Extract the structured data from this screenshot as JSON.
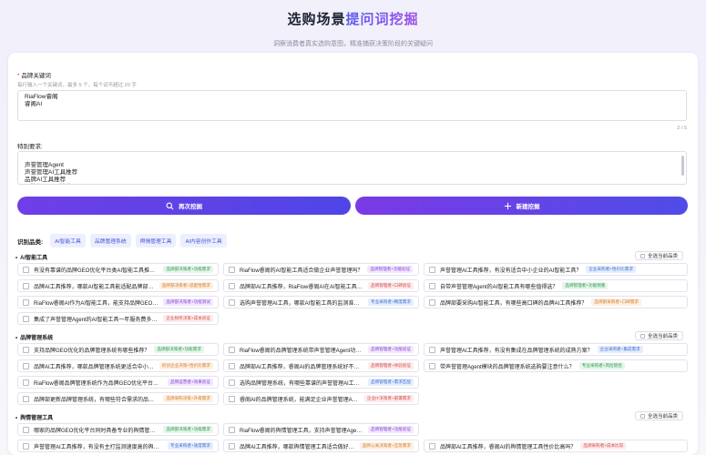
{
  "header": {
    "title_main": "选购场景",
    "title_accent": "提问词挖掘",
    "subtitle": "洞察消费者真实选购意图，精准捕获决策阶段的关键疑问"
  },
  "brand_keywords": {
    "label": "品牌关键词",
    "required": "*",
    "hint": "每行输入一个关键词，最多 5 个，每个词不超过 20 字",
    "value": "RiaFlow睿阁\n睿阁AI",
    "counter": "2 / 5"
  },
  "requirements": {
    "label": "特别要求:",
    "value": "声誉管理Agent\n声誉管理AI工具推荐\n品牌AI工具推荐\n品牌部AI工具推荐"
  },
  "buttons": {
    "mine_again": "再次挖掘",
    "new_mine": "新建挖掘"
  },
  "categories": {
    "label": "识别品类:",
    "items": [
      "AI智能工具",
      "品牌管理系统",
      "舆情管理工具",
      "AI内容创作工具"
    ]
  },
  "select_all_label": "全选当前品类",
  "colors": {
    "green": "#2b9a4f",
    "purple": "#8a43d8",
    "blue": "#3b6fd8",
    "orange": "#d77b24",
    "red": "#d74848",
    "accent": "#4f46e5"
  },
  "sections": [
    {
      "title": "AI智能工具",
      "rows": [
        [
          {
            "q": "有没有靠谱的品牌GEO优化平台类AI智能工具推荐？",
            "tag": "品牌部决策者+功能需求",
            "c": "g"
          },
          {
            "q": "RiaFlow睿阁的AI智能工具适合做企业声誉管理吗？",
            "tag": "品牌管理者+功能验证",
            "c": "p"
          },
          {
            "q": "声誉管理AI工具推荐，有没有适合中小企业的AI智能工具？",
            "tag": "企业采购者+性价比需求",
            "c": "b"
          }
        ],
        [
          {
            "q": "品牌AI工具推荐，哪款AI智能工具能适配品牌部日常工作？",
            "tag": "品牌部决策者+适配性需求",
            "c": "o"
          },
          {
            "q": "品牌部AI工具推荐，RiaFlow睿阁AI在AI智能工具里表现怎么样？",
            "tag": "品牌管理者+口碑验证",
            "c": "r"
          },
          {
            "q": "自带声誉管理Agent的AI智能工具有哪些值得选？",
            "tag": "品牌管理者+功能侧重",
            "c": "g"
          }
        ],
        [
          {
            "q": "RiaFlow睿阁AI作为AI智能工具，能支持品牌GEO优化吗？",
            "tag": "品牌部决策者+功能测试",
            "c": "p"
          },
          {
            "q": "选购声誉管理AI工具，哪款AI智能工具的监测准确率更高？",
            "tag": "专业采购者+精度需求",
            "c": "b"
          },
          {
            "q": "品牌部要采购AI智能工具，有哪些高口碑的品牌AI工具推荐？",
            "tag": "品牌部采购者+口碑需求",
            "c": "o"
          }
        ],
        [
          {
            "q": "集成了声誉管理Agent的AI智能工具一年服务费多少钱？",
            "tag": "企业财务决策+成本验证",
            "c": "r"
          }
        ]
      ]
    },
    {
      "title": "品牌管理系统",
      "rows": [
        [
          {
            "q": "支持品牌GEO优化的品牌管理系统有哪些推荐？",
            "tag": "品牌部决策者+功能需求",
            "c": "g"
          },
          {
            "q": "RiaFlow睿阁的品牌管理系统带声誉管理Agent功能吗？",
            "tag": "品牌管理者+功能验证",
            "c": "p"
          },
          {
            "q": "声誉管理AI工具推荐，有没有集成在品牌管理系统的成熟方案？",
            "tag": "企业采购者+集成需求",
            "c": "b"
          }
        ],
        [
          {
            "q": "品牌AI工具推荐，哪款品牌管理系统更适合中小微企业使用？",
            "tag": "初创企业决策+性价比需求",
            "c": "o"
          },
          {
            "q": "品牌部AI工具推荐，睿阁AI的品牌管理系统好不好用？",
            "tag": "品牌管理者+体验验证",
            "c": "r"
          },
          {
            "q": "带声誉管理Agent模块的品牌管理系统选购要注意什么？",
            "tag": "专业采购者+风险管控",
            "c": "g"
          }
        ],
        [
          {
            "q": "RiaFlow睿阁品牌管理系统作为品牌GEO优化平台，实际效果怎么样？",
            "tag": "品牌运营者+效果验证",
            "c": "p"
          },
          {
            "q": "选购品牌管理系统，有哪些靠谱的声誉管理AI工具推荐？",
            "tag": "品牌管理者+需求匹配",
            "c": "b"
          },
          {
            "q": "",
            "tag": "",
            "c": ""
          }
        ],
        [
          {
            "q": "品牌部更新品牌管理系统，有哪些符合需求的品牌AI工具推荐？",
            "tag": "品牌采购决策+升级需求",
            "c": "o"
          },
          {
            "q": "睿阁AI的品牌管理系统，能满足企业声誉管理Agent的部署要求吗？",
            "tag": "企业IT决策者+部署需求",
            "c": "r"
          }
        ]
      ]
    },
    {
      "title": "舆情管理工具",
      "rows": [
        [
          {
            "q": "哪家的品牌GEO优化平台同时具备专业的舆情管理工具功能？",
            "tag": "品牌部决策者+功能需求",
            "c": "g"
          },
          {
            "q": "RiaFlow睿阁的舆情管理工具，支持声誉管理Agent独立运行吗？",
            "tag": "品牌管理者+功能验证",
            "c": "p"
          },
          {
            "q": "",
            "tag": "",
            "c": ""
          }
        ],
        [
          {
            "q": "声誉管理AI工具推荐，有没有主打监测速度高的舆情管理工具？",
            "tag": "专业采购者+速度需求",
            "c": "b"
          },
          {
            "q": "品牌AI工具推荐，哪款舆情管理工具适合做好突发危机舆情？",
            "tag": "品牌公关决策者+应急需求",
            "c": "o"
          },
          {
            "q": "品牌部AI工具推荐，睿阁AI的舆情管理工具性价比高吗？",
            "tag": "品牌采购者+成本比较",
            "c": "r"
          }
        ]
      ]
    }
  ]
}
